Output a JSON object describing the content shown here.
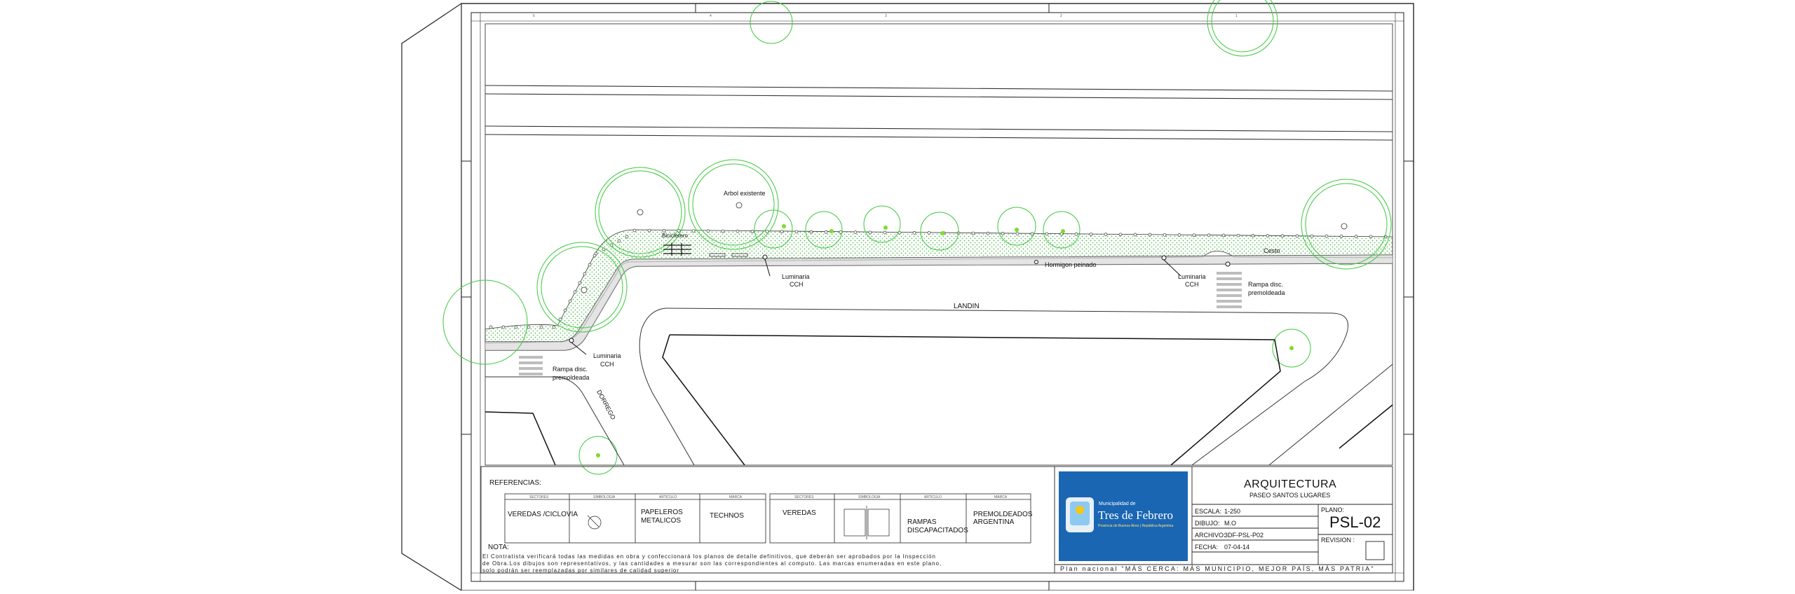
{
  "plan": {
    "labels": {
      "arbol": "Arbol existente",
      "bicicletero": "Bicicletero",
      "luminaria": "Luminaria",
      "cch": "CCH",
      "hormigon": "Hormigon peinado",
      "cesto": "Cesto",
      "rampa_1": "Rampa disc.",
      "rampa_2": "premoldeada",
      "landin": "LANDIN",
      "dorrego": "DORREGO"
    },
    "ruler_numbers": [
      "6",
      "4",
      "3",
      "2",
      "1"
    ]
  },
  "references": {
    "title": "REFERENCIAS:",
    "col_headers": [
      "SECTORES",
      "SIMBOLOGIA",
      "ARTICULO",
      "MARCA"
    ],
    "left_row": {
      "sector": "VEREDAS /CICLOVIA",
      "articulo_1": "PAPELEROS",
      "articulo_2": "METALICOS",
      "marca": "TECHNOS"
    },
    "right_row": {
      "sector": "VEREDAS",
      "articulo_1": "RAMPAS",
      "articulo_2": "DISCAPACITADOS",
      "marca_1": "PREMOLDEADOS",
      "marca_2": "ARGENTINA"
    },
    "nota_title": "NOTA:",
    "nota_lines": [
      "El Contratista verificará todas las medidas en obra y confeccionará los planos de detalle definitivos, que deberán ser aprobados por la Inspección",
      "de Obra.Los dibujos son representativos, y las cantidades a mesurar son las correspondientes al computo. Las marcas enumeradas en este plano,",
      "solo podrán ser reemplazadas por similares de calidad superior"
    ]
  },
  "title_block": {
    "logo_small": "Municipalidad de",
    "logo_name": "Tres de Febrero",
    "logo_sub": "Provincia de Buenos Aires | República Argentina",
    "heading": "ARQUITECTURA",
    "subheading": "PASEO SANTOS LUGARES",
    "escala_label": "ESCALA:",
    "escala": "1-250",
    "dibujo_label": "DIBUJO:",
    "dibujo": "M.O",
    "archivo_label": "ARCHIVO:",
    "archivo": "3DF-PSL-P02",
    "fecha_label": "FECHA:",
    "fecha": "07-04-14",
    "plano_label": "PLANO:",
    "plano": "PSL-02",
    "revision_label": "REVISION :",
    "slogan": "Plan nacional \"MÁS CERCA: MÁS MUNICIPIO, MEJOR PAÍS, MÁS PATRIA\""
  },
  "colors": {
    "line": "#222222",
    "tree": "#3cc83c",
    "tree_fill": "#7ddc2a",
    "hatch": "#55b855",
    "logo_blue": "#1a66b3"
  }
}
